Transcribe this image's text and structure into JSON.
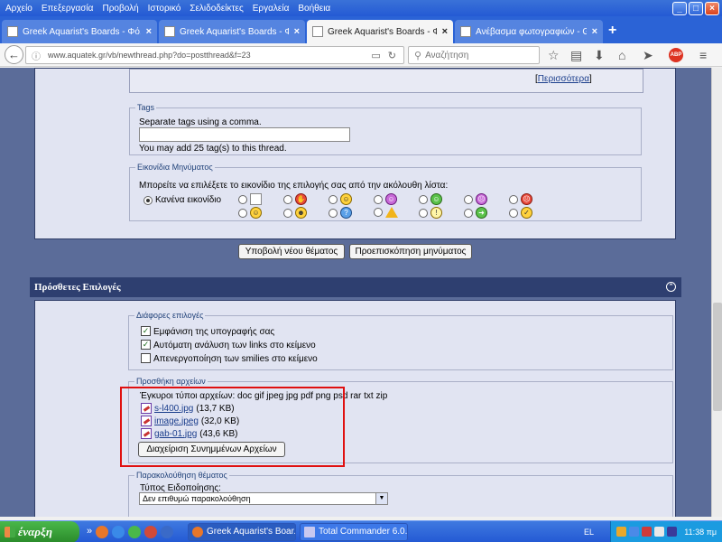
{
  "menubar": {
    "items": [
      "Αρχείο",
      "Επεξεργασία",
      "Προβολή",
      "Ιστορικό",
      "Σελιδοδείκτες",
      "Εργαλεία",
      "Βοήθεια"
    ]
  },
  "tabs": [
    {
      "label": "Greek Aquarist's Boards - Φό..."
    },
    {
      "label": "Greek Aquarist's Boards - Φό..."
    },
    {
      "label": "Greek Aquarist's Boards - Φό..."
    },
    {
      "label": "Ανέβασμα φωτογραφιών - Gr..."
    }
  ],
  "newtab_label": "+",
  "navbar": {
    "url": "www.aquatek.gr/vb/newthread.php?do=postthread&f=23",
    "search_placeholder": "Αναζήτηση",
    "abp": "ABP"
  },
  "top_panel": {
    "more_link": "Περισσότερα"
  },
  "tags": {
    "legend": "Tags",
    "hint": "Separate tags using a comma.",
    "note": "You may add 25 tag(s) to this thread."
  },
  "icons_section": {
    "legend": "Εικονίδια Μηνύματος",
    "instruction": "Μπορείτε να επιλέξετε το εικονίδιο της επιλογής σας από την ακόλουθη λίστα:",
    "none_option": "Κανένα εικονίδιο"
  },
  "actions": {
    "submit": "Υποβολή νέου θέματος",
    "preview": "Προεπισκόπηση μηνύματος"
  },
  "additional": {
    "title": "Πρόσθετες Επιλογές",
    "misc_legend": "Διάφορες επιλογές",
    "options": [
      {
        "label": "Εμφάνιση της υπογραφής σας",
        "checked": true
      },
      {
        "label": "Αυτόματη ανάλυση των links στο κείμενο",
        "checked": true
      },
      {
        "label": "Απενεργοποίηση των smilies στο κείμενο",
        "checked": false
      }
    ],
    "attach_legend": "Προσθήκη αρχείων",
    "valid_types": "Έγκυροι τύποι αρχείων: doc gif jpeg jpg pdf png psd rar txt zip",
    "files": [
      {
        "name": "s-l400.jpg",
        "size": "(13,7 KB)"
      },
      {
        "name": "image.jpeg",
        "size": "(32,0 KB)"
      },
      {
        "name": "gab-01.jpg",
        "size": "(43,6 KB)"
      }
    ],
    "manage_button": "Διαχείριση Συνημμένων Αρχείων",
    "subscribe_legend": "Παρακολούθηση θέματος",
    "notify_label": "Τύπος Ειδοποίησης:",
    "notify_value": "Δεν επιθυμώ παρακολούθηση"
  },
  "taskbar": {
    "start": "έναρξη",
    "chevron": "»",
    "tasks": [
      {
        "label": "Greek Aquarist's Boar..."
      },
      {
        "label": "Total Commander 6.0..."
      }
    ],
    "lang": "EL",
    "clock": "11:38 πμ"
  },
  "colors": {
    "page_bg": "#5b6c99",
    "panel_bg": "#e1e4f2",
    "header_bg": "#2e3f70",
    "highlight": "#e01010"
  }
}
